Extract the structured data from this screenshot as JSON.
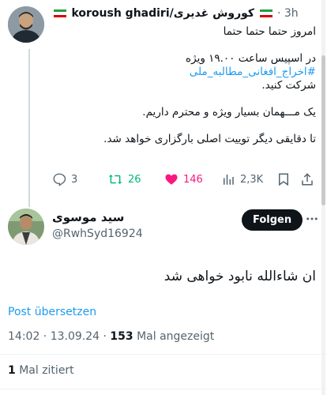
{
  "parent_tweet": {
    "author_name": "koroush ghadiri/کوروش غدیری",
    "time": "3h",
    "separator": "·",
    "text_lines": [
      "امروز حتما حتما حتما",
      "",
      "در اسپیس ساعت ۱۹.۰۰ ویژه",
      "#اخراج_افغانی_مطالبه_ملی",
      "شرکت کنید.",
      "",
      "یک مـــهمان بسیار ویژه و محترم داریم.",
      "",
      "تا دقایقی دیگر توییت اصلی بارگزاری خواهد شد."
    ],
    "stats": {
      "replies": "3",
      "reposts": "26",
      "likes": "146",
      "views": "2,3K"
    }
  },
  "reply_tweet": {
    "author_name": "سید موسوی",
    "handle": "@RwhSyd16924",
    "follow_label": "Folgen",
    "text": "ان شاءالله نابود خواهی شد",
    "translate_label": "Post übersetzen",
    "timestamp": "14:02 · 13.09.24 · ",
    "views_count": "153",
    "views_label": " Mal angezeigt",
    "quotes_count": "1",
    "quotes_label": " Mal zitiert"
  },
  "colors": {
    "accent": "#1d9bf0",
    "repost_green": "#00ba7c",
    "like_pink": "#f91880",
    "muted": "#536471"
  }
}
